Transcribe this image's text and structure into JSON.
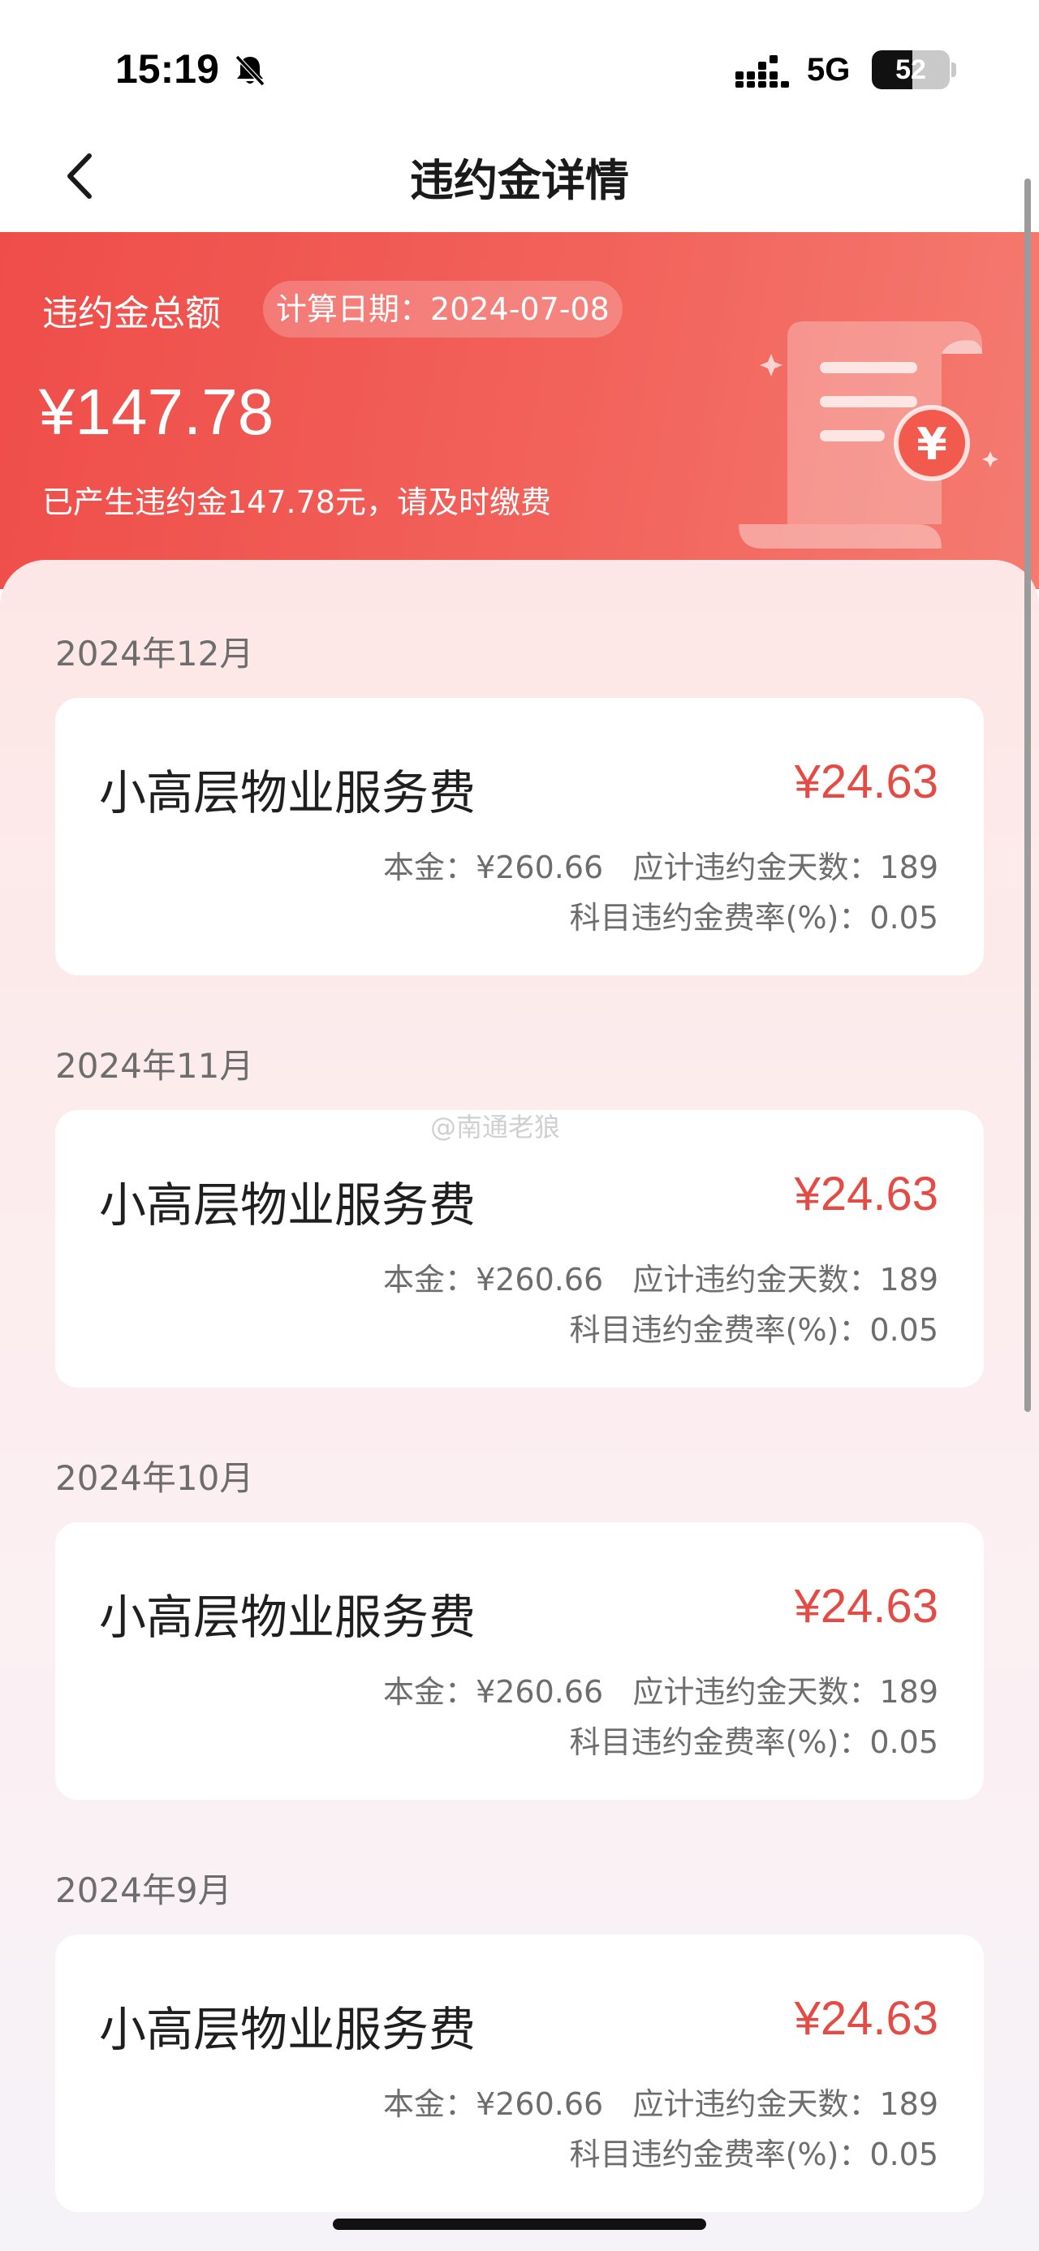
{
  "status_bar": {
    "time": "15:19",
    "network": "5G",
    "battery_level": "52",
    "battery_fraction": 0.52,
    "icons": [
      "bell-off-icon",
      "signal-icon"
    ]
  },
  "nav": {
    "title": "违约金详情",
    "back_icon": "chevron-left-icon"
  },
  "summary": {
    "title": "违约金总额",
    "date_label": "计算日期：",
    "date": "2024-07-08",
    "total": "¥147.78",
    "note": "已产生违约金147.78元，请及时缴费"
  },
  "records": [
    {
      "month": "2024年12月",
      "name": "小高层物业服务费",
      "amount": "¥24.63",
      "principal_label": "本金：",
      "principal": "¥260.66",
      "days_label": "应计违约金天数：",
      "days": "189",
      "rate_label": "科目违约金费率(%)：",
      "rate": "0.05"
    },
    {
      "month": "2024年11月",
      "name": "小高层物业服务费",
      "amount": "¥24.63",
      "principal_label": "本金：",
      "principal": "¥260.66",
      "days_label": "应计违约金天数：",
      "days": "189",
      "rate_label": "科目违约金费率(%)：",
      "rate": "0.05"
    },
    {
      "month": "2024年10月",
      "name": "小高层物业服务费",
      "amount": "¥24.63",
      "principal_label": "本金：",
      "principal": "¥260.66",
      "days_label": "应计违约金天数：",
      "days": "189",
      "rate_label": "科目违约金费率(%)：",
      "rate": "0.05"
    },
    {
      "month": "2024年9月",
      "name": "小高层物业服务费",
      "amount": "¥24.63",
      "principal_label": "本金：",
      "principal": "¥260.66",
      "days_label": "应计违约金天数：",
      "days": "189",
      "rate_label": "科目违约金费率(%)：",
      "rate": "0.05"
    }
  ],
  "watermark": "@南通老狼",
  "colors": {
    "banner_start": "#ef4d49",
    "banner_end": "#f47b70",
    "amount_red": "#e54b45",
    "muted_text": "#6d6d6d"
  }
}
